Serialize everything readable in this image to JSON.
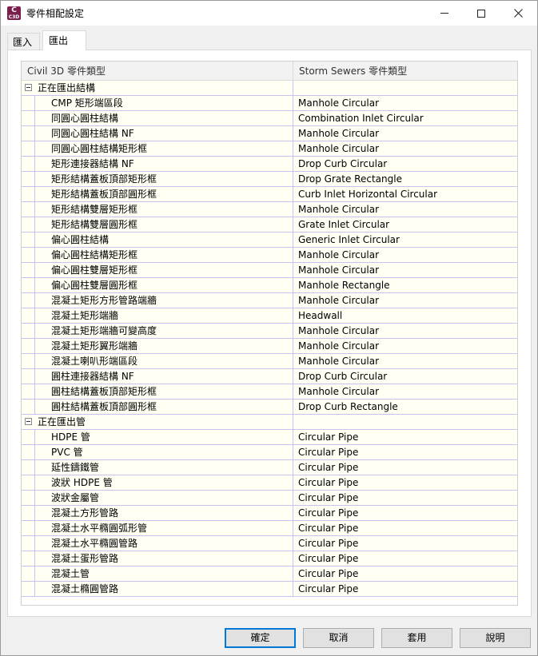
{
  "window": {
    "title": "零件相配設定",
    "app_icon_text": "C3D",
    "controls": [
      "minimize-icon",
      "maximize-icon",
      "close-icon"
    ]
  },
  "tabs": [
    {
      "label": "匯入"
    },
    {
      "label": "匯出"
    }
  ],
  "grid": {
    "headers": [
      "Civil 3D 零件類型",
      "Storm Sewers 零件類型"
    ],
    "groups": [
      {
        "label": "正在匯出結構",
        "rows": [
          [
            "CMP 矩形端區段",
            "Manhole Circular"
          ],
          [
            "同圓心圓柱結構",
            "Combination Inlet Circular"
          ],
          [
            "同圓心圓柱結構 NF",
            "Manhole Circular"
          ],
          [
            "同圓心圓柱結構矩形框",
            "Manhole Circular"
          ],
          [
            "矩形連接器結構 NF",
            "Drop Curb Circular"
          ],
          [
            "矩形結構蓋板頂部矩形框",
            "Drop Grate Rectangle"
          ],
          [
            "矩形結構蓋板頂部圓形框",
            "Curb Inlet Horizontal Circular"
          ],
          [
            "矩形結構雙層矩形框",
            "Manhole Circular"
          ],
          [
            "矩形結構雙層圓形框",
            "Grate Inlet Circular"
          ],
          [
            "偏心圓柱結構",
            "Generic Inlet Circular"
          ],
          [
            "偏心圓柱結構矩形框",
            "Manhole Circular"
          ],
          [
            "偏心圓柱雙層矩形框",
            "Manhole Circular"
          ],
          [
            "偏心圓柱雙層圓形框",
            "Manhole Rectangle"
          ],
          [
            "混凝土矩形方形管路端牆",
            "Manhole Circular"
          ],
          [
            "混凝土矩形端牆",
            "Headwall"
          ],
          [
            "混凝土矩形端牆可變高度",
            "Manhole Circular"
          ],
          [
            "混凝土矩形翼形端牆",
            "Manhole Circular"
          ],
          [
            "混凝土喇叭形端區段",
            "Manhole Circular"
          ],
          [
            "圓柱連接器結構 NF",
            "Drop Curb Circular"
          ],
          [
            "圓柱結構蓋板頂部矩形框",
            "Manhole Circular"
          ],
          [
            "圓柱結構蓋板頂部圓形框",
            "Drop Curb Rectangle"
          ]
        ]
      },
      {
        "label": "正在匯出管",
        "rows": [
          [
            "HDPE 管",
            "Circular Pipe"
          ],
          [
            "PVC 管",
            "Circular Pipe"
          ],
          [
            "延性鑄鐵管",
            "Circular Pipe"
          ],
          [
            "波狀 HDPE 管",
            "Circular Pipe"
          ],
          [
            "波狀金屬管",
            "Circular Pipe"
          ],
          [
            "混凝土方形管路",
            "Circular Pipe"
          ],
          [
            "混凝土水平橢圓弧形管",
            "Circular Pipe"
          ],
          [
            "混凝土水平橢圓管路",
            "Circular Pipe"
          ],
          [
            "混凝土蛋形管路",
            "Circular Pipe"
          ],
          [
            "混凝土管",
            "Circular Pipe"
          ],
          [
            "混凝土橢圓管路",
            "Circular Pipe"
          ]
        ]
      }
    ]
  },
  "buttons": {
    "ok": "確定",
    "cancel": "取消",
    "apply": "套用",
    "help": "說明"
  }
}
